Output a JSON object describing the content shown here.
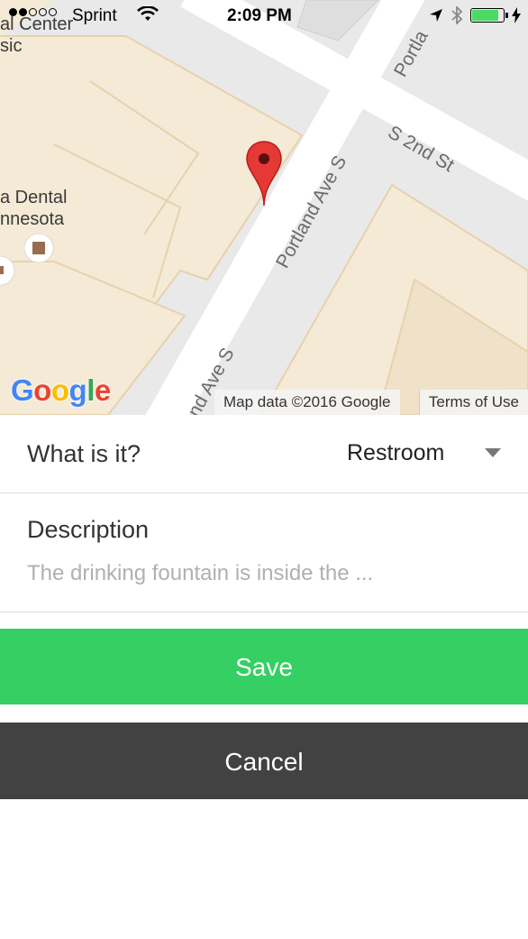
{
  "status_bar": {
    "carrier": "Sprint",
    "time": "2:09 PM"
  },
  "map": {
    "streets": {
      "portland_main": "Portland Ave S",
      "portland_lower": "nd Ave S",
      "portland_top": "Portla",
      "second_st": "S 2nd St"
    },
    "places": {
      "line1": "al Center",
      "line2": "sic",
      "line3": "a Dental",
      "line4": "nnesota"
    },
    "logo": "Google",
    "attribution": "Map data ©2016 Google",
    "terms": "Terms of Use"
  },
  "form": {
    "type_label": "What is it?",
    "type_value": "Restroom",
    "description_label": "Description",
    "description_value": "The drinking fountain is inside the ..."
  },
  "buttons": {
    "save": "Save",
    "cancel": "Cancel"
  },
  "colors": {
    "save": "#35cf63",
    "cancel": "#424242",
    "pin": "#e53935"
  }
}
